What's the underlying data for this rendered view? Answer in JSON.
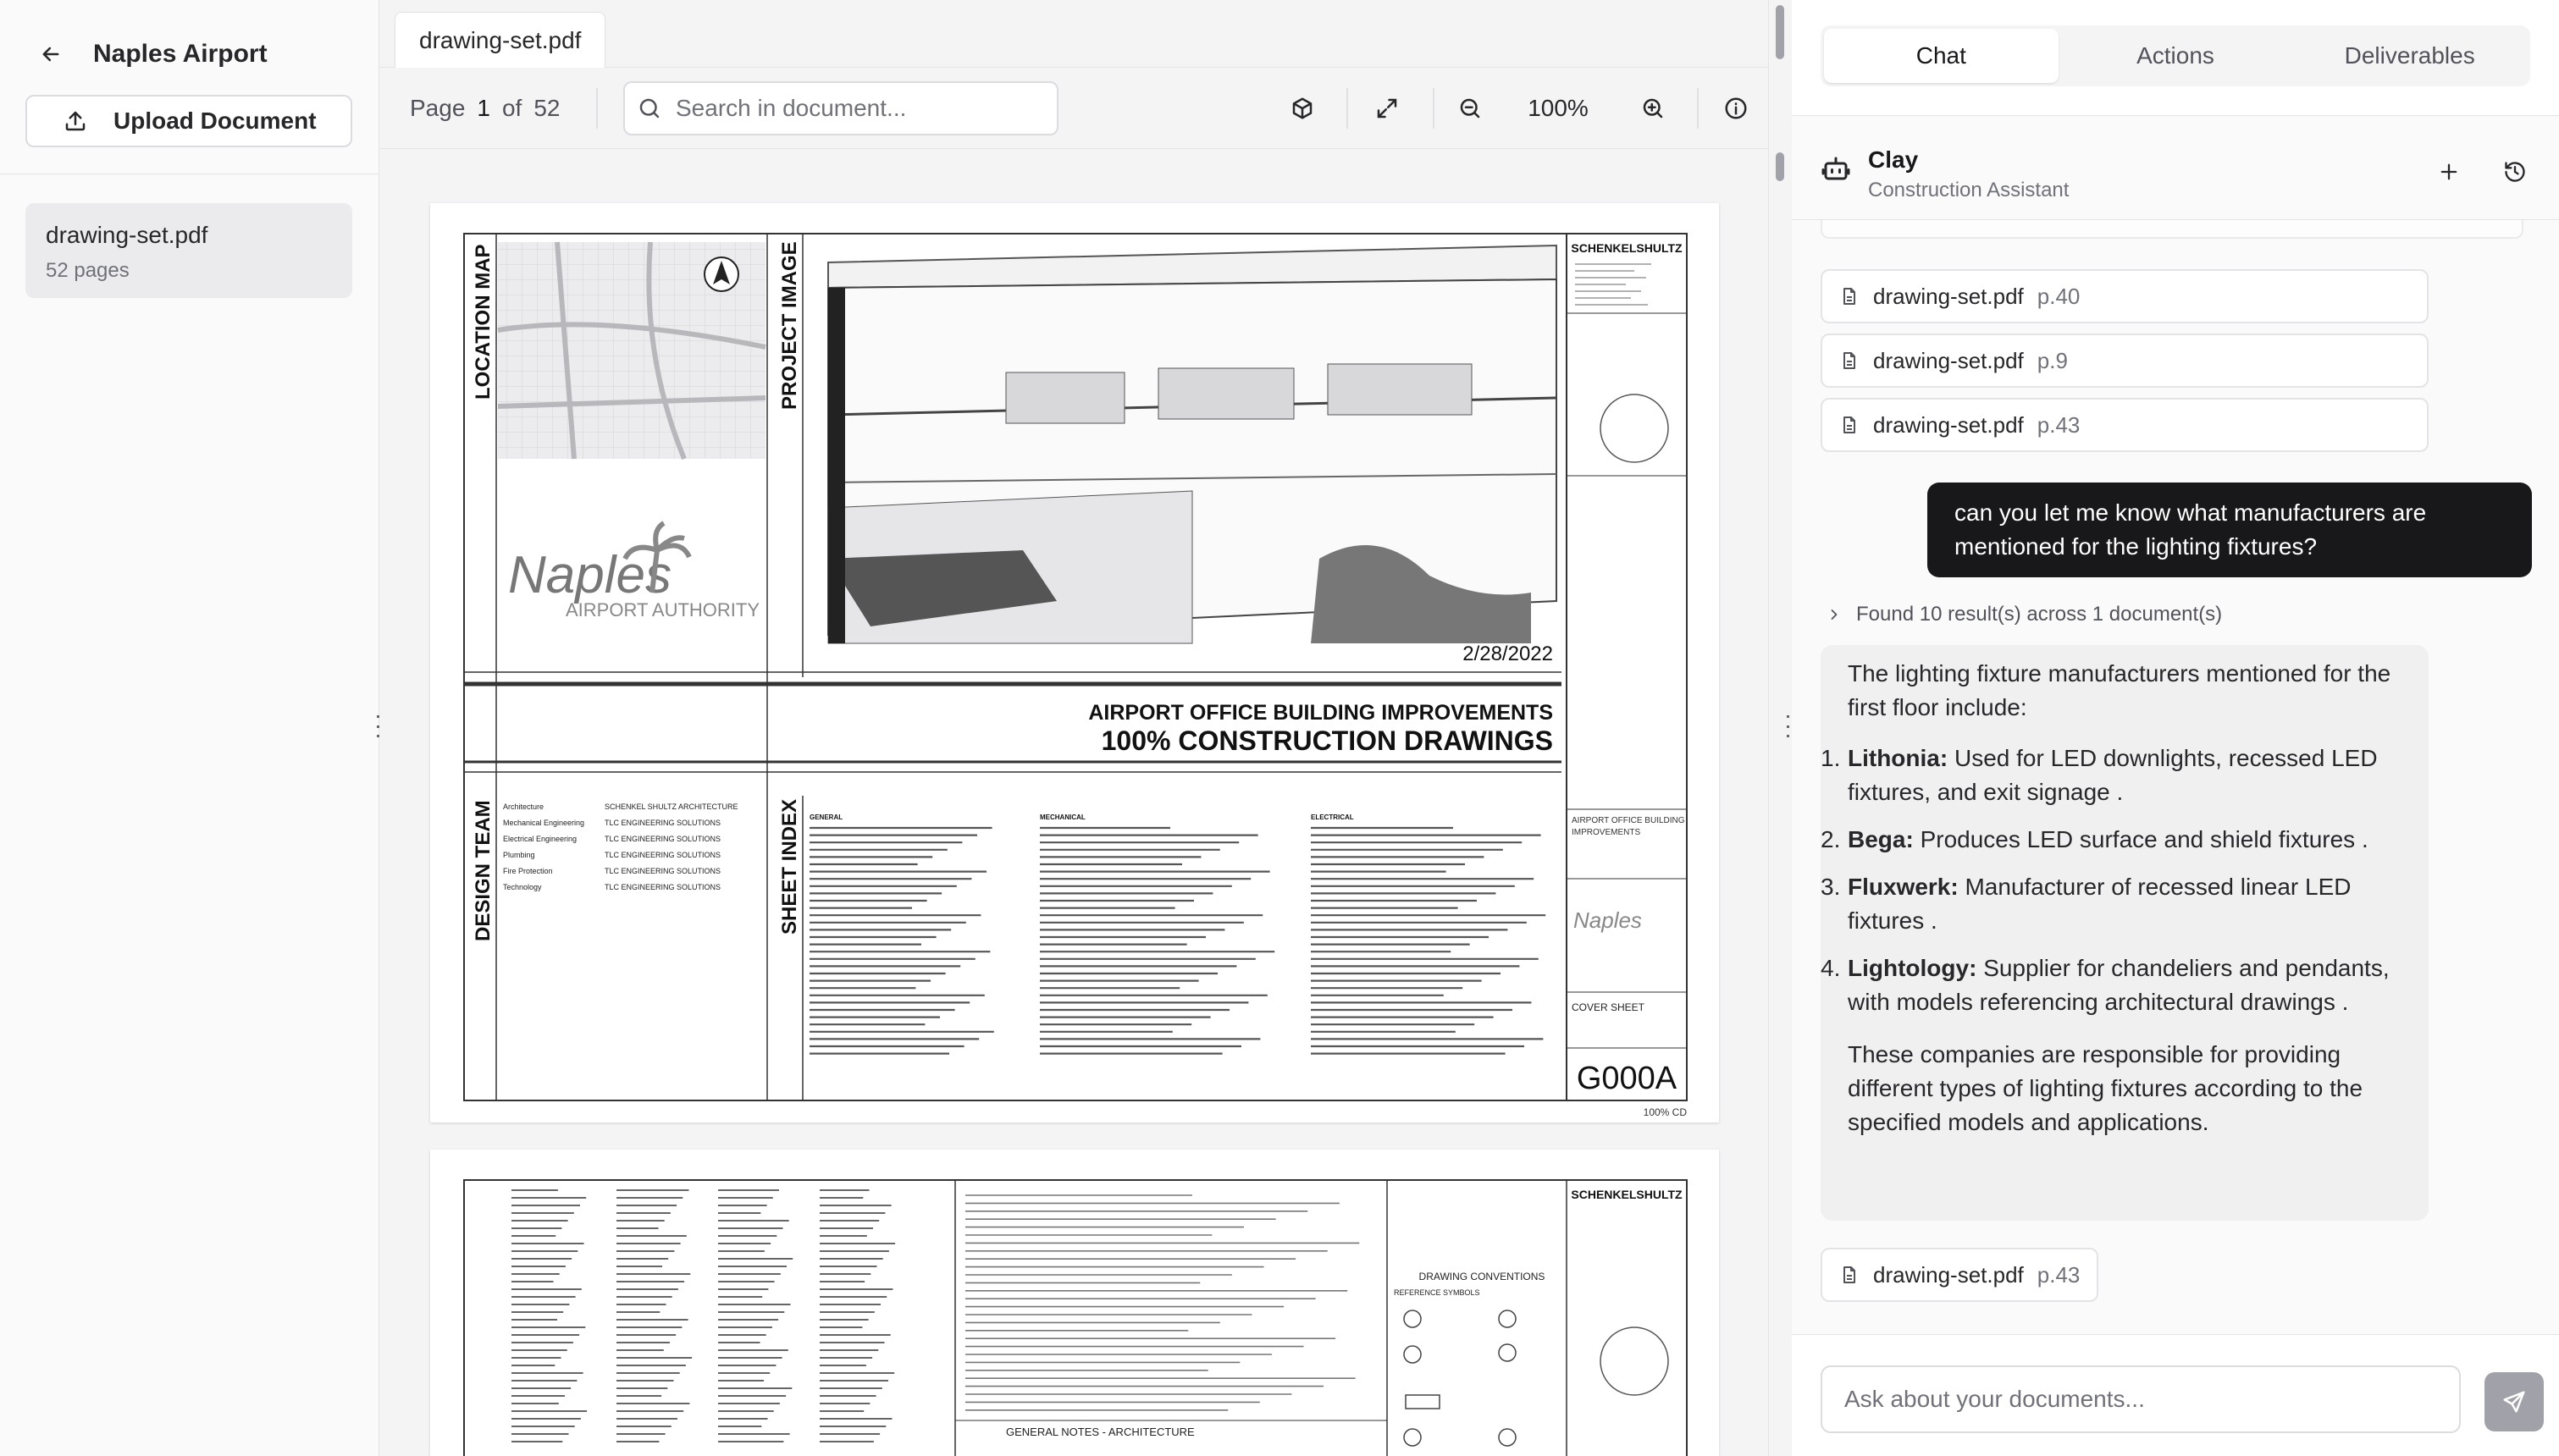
{
  "sidebar": {
    "project_title": "Naples Airport",
    "upload_label": "Upload Document",
    "documents": [
      {
        "name": "drawing-set.pdf",
        "pages": "52 pages"
      }
    ]
  },
  "viewer": {
    "file_tab": "drawing-set.pdf",
    "page_label": "Page",
    "current_page": "1",
    "of_label": "of",
    "total_pages": "52",
    "search_placeholder": "Search in document...",
    "zoom": "100%"
  },
  "sheet1": {
    "location_map": "LOCATION MAP",
    "project_image": "PROJECT IMAGE",
    "design_team": "DESIGN TEAM",
    "sheet_index": "SHEET INDEX",
    "logo_script": "Naples",
    "logo_sub": "AIRPORT AUTHORITY",
    "date": "2/28/2022",
    "project_name": "AIRPORT OFFICE BUILDING IMPROVEMENTS",
    "drawing_set": "100% CONSTRUCTION DRAWINGS",
    "firm": "SCHENKELSHULTZ",
    "sheet_title": "COVER SHEET",
    "sheet_number": "G000A",
    "stamp": "100% CD",
    "team": [
      {
        "role": "Architecture",
        "firm": "SCHENKEL SHULTZ ARCHITECTURE"
      },
      {
        "role": "Mechanical Engineering",
        "firm": "TLC ENGINEERING SOLUTIONS"
      },
      {
        "role": "Electrical Engineering",
        "firm": "TLC ENGINEERING SOLUTIONS"
      },
      {
        "role": "Plumbing",
        "firm": "TLC ENGINEERING SOLUTIONS"
      },
      {
        "role": "Fire Protection",
        "firm": "TLC ENGINEERING SOLUTIONS"
      },
      {
        "role": "Technology",
        "firm": "TLC ENGINEERING SOLUTIONS"
      }
    ],
    "index_headings": [
      "GENERAL",
      "MECHANICAL",
      "ELECTRICAL"
    ],
    "project_block": "AIRPORT OFFICE BUILDING IMPROVEMENTS"
  },
  "sheet2": {
    "drawing_conventions": "DRAWING CONVENTIONS",
    "reference_symbols": "REFERENCE SYMBOLS",
    "general_notes": "GENERAL NOTES - ARCHITECTURE",
    "firm": "SCHENKELSHULTZ"
  },
  "chat": {
    "tabs": [
      {
        "label": "Chat",
        "active": true
      },
      {
        "label": "Actions",
        "active": false
      },
      {
        "label": "Deliverables",
        "active": false
      }
    ],
    "assistant_name": "Clay",
    "assistant_role": "Construction Assistant",
    "citations_top": [
      {
        "file": "drawing-set.pdf",
        "page": "p.40"
      },
      {
        "file": "drawing-set.pdf",
        "page": "p.9"
      },
      {
        "file": "drawing-set.pdf",
        "page": "p.43"
      }
    ],
    "user_message": "can you let me know what manufacturers are mentioned for the lighting fixtures?",
    "found_text": "Found 10 result(s) across 1 document(s)",
    "answer_intro": "The lighting fixture manufacturers mentioned for the first floor include:",
    "answer_items": [
      {
        "num": "1.",
        "name": "Lithonia:",
        "text": "Used for LED downlights, recessed LED fixtures, and exit signage ."
      },
      {
        "num": "2.",
        "name": "Bega:",
        "text": "Produces LED surface and shield fixtures ."
      },
      {
        "num": "3.",
        "name": "Fluxwerk:",
        "text": "Manufacturer of recessed linear LED fixtures ."
      },
      {
        "num": "4.",
        "name": "Lightology:",
        "text": "Supplier for chandeliers and pendants, with models referencing architectural drawings ."
      }
    ],
    "answer_outro": "These companies are responsible for providing different types of lighting fixtures according to the specified models and applications.",
    "citation_bottom": {
      "file": "drawing-set.pdf",
      "page": "p.43"
    },
    "input_placeholder": "Ask about your documents..."
  }
}
